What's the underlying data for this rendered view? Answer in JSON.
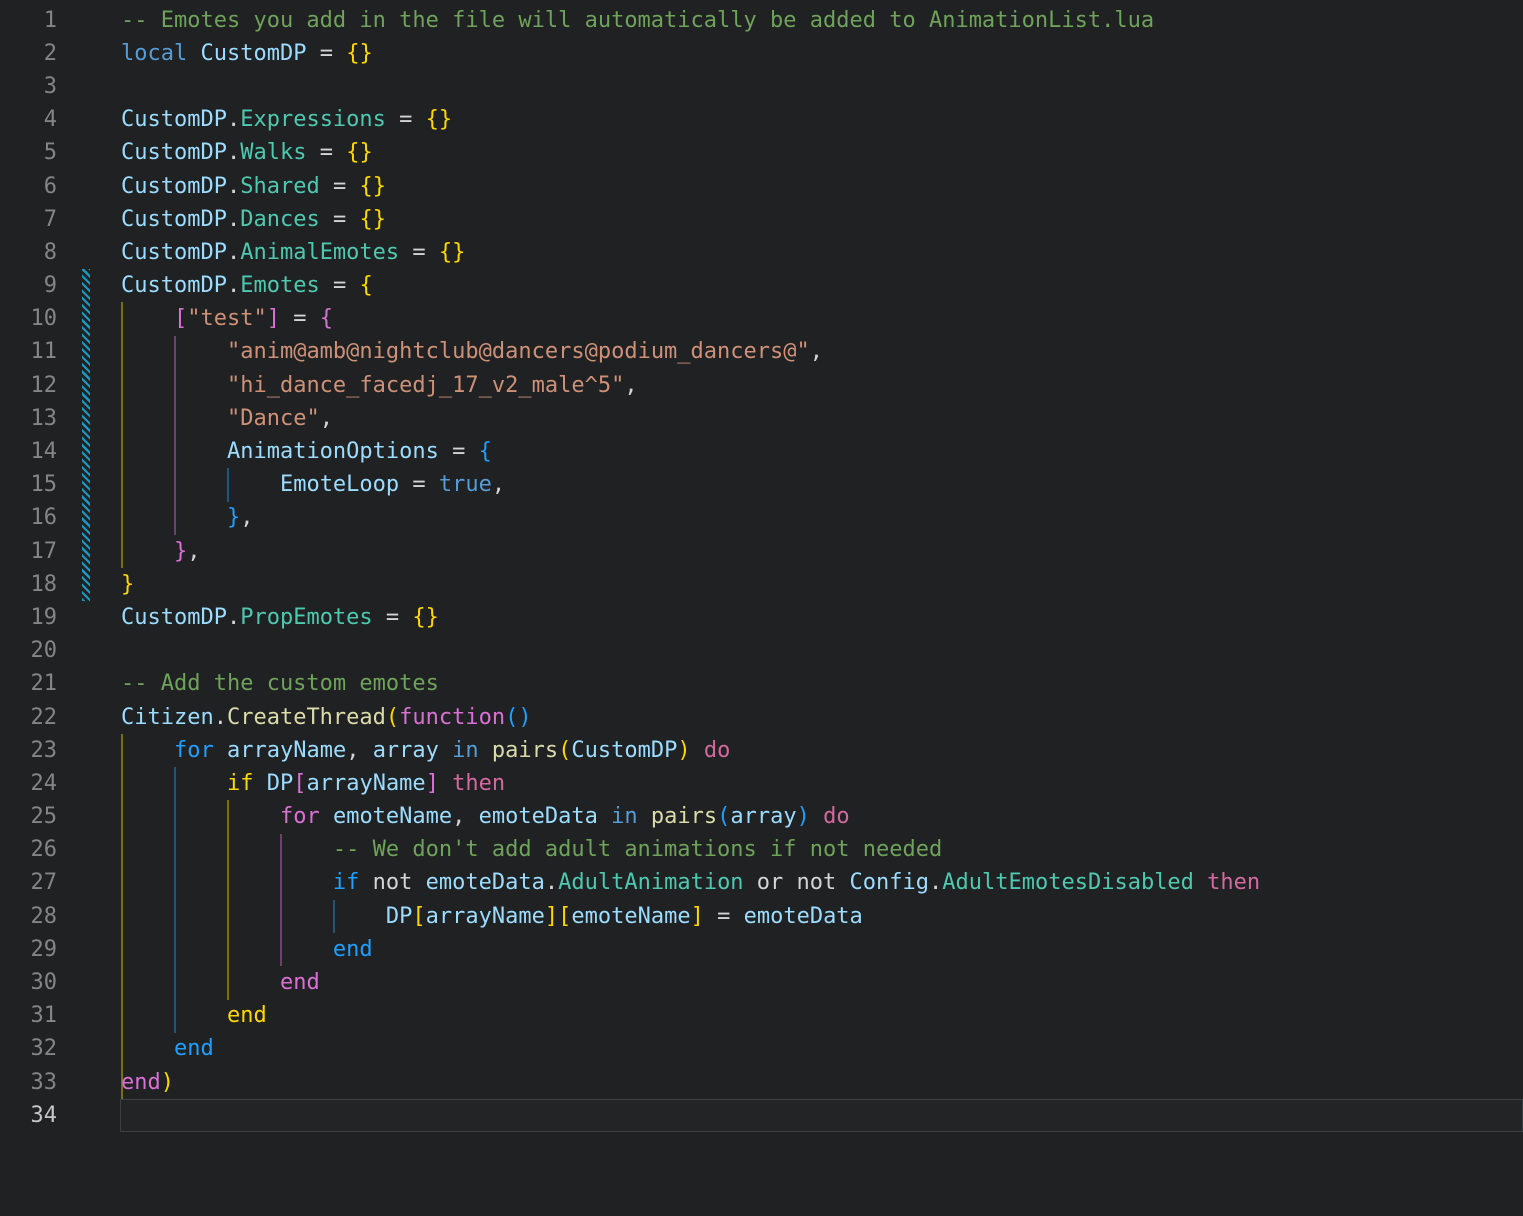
{
  "palette": {
    "background": "#1f2122",
    "lineNumber": "#858585",
    "lineNumberActive": "#c6c6c6",
    "cm": "#6fa25a",
    "kw": "#569cd6",
    "ctrl": "#d3699f",
    "v": "#9cdcfe",
    "p": "#4ec9b0",
    "fn": "#dcdcaa",
    "s": "#ce9178",
    "pl": "#d4d4d4",
    "b1": "#ffd700",
    "b2": "#da70d6",
    "b3": "#1f9fff",
    "modified": "#1899c2",
    "activeLineBorder": "#3c4042"
  },
  "editor": {
    "language_hint": "lua",
    "active_line": 34,
    "modified_indicator": {
      "from": 9,
      "to": 18
    },
    "guides": [
      {
        "col": 0,
        "from": 10,
        "to": 17,
        "level": "b1"
      },
      {
        "col": 4,
        "from": 11,
        "to": 16,
        "level": "b2"
      },
      {
        "col": 8,
        "from": 15,
        "to": 15,
        "level": "b3"
      },
      {
        "col": 0,
        "from": 23,
        "to": 33,
        "level": "b1"
      },
      {
        "col": 4,
        "from": 24,
        "to": 31,
        "level": "b3"
      },
      {
        "col": 8,
        "from": 25,
        "to": 30,
        "level": "b1"
      },
      {
        "col": 12,
        "from": 26,
        "to": 29,
        "level": "b2"
      },
      {
        "col": 16,
        "from": 28,
        "to": 28,
        "level": "b3"
      }
    ],
    "lines": [
      {
        "num": "1",
        "tokens": [
          [
            "-- Emotes you add in the file will automatically be added to AnimationList.lua",
            "cm"
          ]
        ]
      },
      {
        "num": "2",
        "tokens": [
          [
            "local",
            "kw"
          ],
          [
            " CustomDP",
            "v"
          ],
          [
            " = ",
            "pl"
          ],
          [
            "{}",
            "b1"
          ]
        ]
      },
      {
        "num": "3",
        "tokens": []
      },
      {
        "num": "4",
        "tokens": [
          [
            "CustomDP",
            "v"
          ],
          [
            ".",
            "pl"
          ],
          [
            "Expressions",
            "p"
          ],
          [
            " = ",
            "pl"
          ],
          [
            "{}",
            "b1"
          ]
        ]
      },
      {
        "num": "5",
        "tokens": [
          [
            "CustomDP",
            "v"
          ],
          [
            ".",
            "pl"
          ],
          [
            "Walks",
            "p"
          ],
          [
            " = ",
            "pl"
          ],
          [
            "{}",
            "b1"
          ]
        ]
      },
      {
        "num": "6",
        "tokens": [
          [
            "CustomDP",
            "v"
          ],
          [
            ".",
            "pl"
          ],
          [
            "Shared",
            "p"
          ],
          [
            " = ",
            "pl"
          ],
          [
            "{}",
            "b1"
          ]
        ]
      },
      {
        "num": "7",
        "tokens": [
          [
            "CustomDP",
            "v"
          ],
          [
            ".",
            "pl"
          ],
          [
            "Dances",
            "p"
          ],
          [
            " = ",
            "pl"
          ],
          [
            "{}",
            "b1"
          ]
        ]
      },
      {
        "num": "8",
        "tokens": [
          [
            "CustomDP",
            "v"
          ],
          [
            ".",
            "pl"
          ],
          [
            "AnimalEmotes",
            "p"
          ],
          [
            " = ",
            "pl"
          ],
          [
            "{}",
            "b1"
          ]
        ]
      },
      {
        "num": "9",
        "tokens": [
          [
            "CustomDP",
            "v"
          ],
          [
            ".",
            "pl"
          ],
          [
            "Emotes",
            "p"
          ],
          [
            " = ",
            "pl"
          ],
          [
            "{",
            "b1"
          ]
        ]
      },
      {
        "num": "10",
        "tokens": [
          [
            "    ",
            "pl"
          ],
          [
            "[",
            "b2"
          ],
          [
            "\"test\"",
            "s"
          ],
          [
            "]",
            "b2"
          ],
          [
            " = ",
            "pl"
          ],
          [
            "{",
            "b2"
          ]
        ]
      },
      {
        "num": "11",
        "tokens": [
          [
            "        ",
            "pl"
          ],
          [
            "\"anim@amb@nightclub@dancers@podium_dancers@\"",
            "s"
          ],
          [
            ",",
            "pl"
          ]
        ]
      },
      {
        "num": "12",
        "tokens": [
          [
            "        ",
            "pl"
          ],
          [
            "\"hi_dance_facedj_17_v2_male^5\"",
            "s"
          ],
          [
            ",",
            "pl"
          ]
        ]
      },
      {
        "num": "13",
        "tokens": [
          [
            "        ",
            "pl"
          ],
          [
            "\"Dance\"",
            "s"
          ],
          [
            ",",
            "pl"
          ]
        ]
      },
      {
        "num": "14",
        "tokens": [
          [
            "        ",
            "pl"
          ],
          [
            "AnimationOptions",
            "v"
          ],
          [
            " = ",
            "pl"
          ],
          [
            "{",
            "b3"
          ]
        ]
      },
      {
        "num": "15",
        "tokens": [
          [
            "            ",
            "pl"
          ],
          [
            "EmoteLoop",
            "v"
          ],
          [
            " = ",
            "pl"
          ],
          [
            "true",
            "kw"
          ],
          [
            ",",
            "pl"
          ]
        ]
      },
      {
        "num": "16",
        "tokens": [
          [
            "        ",
            "pl"
          ],
          [
            "}",
            "b3"
          ],
          [
            ",",
            "pl"
          ]
        ]
      },
      {
        "num": "17",
        "tokens": [
          [
            "    ",
            "pl"
          ],
          [
            "}",
            "b2"
          ],
          [
            ",",
            "pl"
          ]
        ]
      },
      {
        "num": "18",
        "tokens": [
          [
            "}",
            "b1"
          ]
        ]
      },
      {
        "num": "19",
        "tokens": [
          [
            "CustomDP",
            "v"
          ],
          [
            ".",
            "pl"
          ],
          [
            "PropEmotes",
            "p"
          ],
          [
            " = ",
            "pl"
          ],
          [
            "{}",
            "b1"
          ]
        ]
      },
      {
        "num": "20",
        "tokens": []
      },
      {
        "num": "21",
        "tokens": [
          [
            "-- Add the custom emotes",
            "cm"
          ]
        ]
      },
      {
        "num": "22",
        "tokens": [
          [
            "Citizen",
            "v"
          ],
          [
            ".",
            "pl"
          ],
          [
            "CreateThread",
            "fn"
          ],
          [
            "(",
            "b1"
          ],
          [
            "function",
            "b2"
          ],
          [
            "(",
            "b3"
          ],
          [
            ")",
            "b3"
          ]
        ]
      },
      {
        "num": "23",
        "tokens": [
          [
            "    ",
            "pl"
          ],
          [
            "for",
            "b3"
          ],
          [
            " arrayName",
            "v"
          ],
          [
            ", ",
            "pl"
          ],
          [
            "array",
            "v"
          ],
          [
            " in ",
            "kw"
          ],
          [
            "pairs",
            "fn"
          ],
          [
            "(",
            "b1"
          ],
          [
            "CustomDP",
            "v"
          ],
          [
            ")",
            "b1"
          ],
          [
            " do",
            "ctrl"
          ]
        ]
      },
      {
        "num": "24",
        "tokens": [
          [
            "        ",
            "pl"
          ],
          [
            "if",
            "b1"
          ],
          [
            " DP",
            "v"
          ],
          [
            "[",
            "b2"
          ],
          [
            "arrayName",
            "v"
          ],
          [
            "]",
            "b2"
          ],
          [
            " then",
            "ctrl"
          ]
        ]
      },
      {
        "num": "25",
        "tokens": [
          [
            "            ",
            "pl"
          ],
          [
            "for",
            "b2"
          ],
          [
            " emoteName",
            "v"
          ],
          [
            ", ",
            "pl"
          ],
          [
            "emoteData",
            "v"
          ],
          [
            " in ",
            "kw"
          ],
          [
            "pairs",
            "fn"
          ],
          [
            "(",
            "b3"
          ],
          [
            "array",
            "v"
          ],
          [
            ")",
            "b3"
          ],
          [
            " do",
            "ctrl"
          ]
        ]
      },
      {
        "num": "26",
        "tokens": [
          [
            "                ",
            "pl"
          ],
          [
            "-- We don't add adult animations if not needed",
            "cm"
          ]
        ]
      },
      {
        "num": "27",
        "tokens": [
          [
            "                ",
            "pl"
          ],
          [
            "if",
            "b3"
          ],
          [
            " not ",
            "pl"
          ],
          [
            "emoteData",
            "v"
          ],
          [
            ".",
            "pl"
          ],
          [
            "AdultAnimation",
            "p"
          ],
          [
            " or not ",
            "pl"
          ],
          [
            "Config",
            "v"
          ],
          [
            ".",
            "pl"
          ],
          [
            "AdultEmotesDisabled",
            "p"
          ],
          [
            " then",
            "ctrl"
          ]
        ]
      },
      {
        "num": "28",
        "tokens": [
          [
            "                    ",
            "pl"
          ],
          [
            "DP",
            "v"
          ],
          [
            "[",
            "b1"
          ],
          [
            "arrayName",
            "v"
          ],
          [
            "]",
            "b1"
          ],
          [
            "[",
            "b1"
          ],
          [
            "emoteName",
            "v"
          ],
          [
            "]",
            "b1"
          ],
          [
            " = ",
            "pl"
          ],
          [
            "emoteData",
            "v"
          ]
        ]
      },
      {
        "num": "29",
        "tokens": [
          [
            "                ",
            "pl"
          ],
          [
            "end",
            "b3"
          ]
        ]
      },
      {
        "num": "30",
        "tokens": [
          [
            "            ",
            "pl"
          ],
          [
            "end",
            "b2"
          ]
        ]
      },
      {
        "num": "31",
        "tokens": [
          [
            "        ",
            "pl"
          ],
          [
            "end",
            "b1"
          ]
        ]
      },
      {
        "num": "32",
        "tokens": [
          [
            "    ",
            "pl"
          ],
          [
            "end",
            "b3"
          ]
        ]
      },
      {
        "num": "33",
        "tokens": [
          [
            "end",
            "b2"
          ],
          [
            ")",
            "b1"
          ]
        ]
      },
      {
        "num": "34",
        "tokens": [],
        "active": true
      }
    ]
  }
}
